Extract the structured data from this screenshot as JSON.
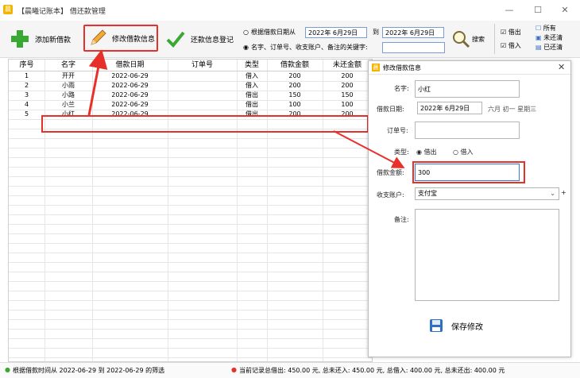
{
  "window": {
    "title": "【晨曦记账本】 借还款管理",
    "icon_glyph": "晨"
  },
  "toolbar": {
    "add_label": "添加新借款",
    "edit_label": "修改借款信息",
    "repay_label": "还款信息登记",
    "radio_date_label": "根据借款日期从",
    "date_from": "2022年 6月29日",
    "to_label": "到",
    "date_to": "2022年 6月29日",
    "radio_keyword_label": "名字、订单号、收支账户、备注的关键字:",
    "keyword_value": "",
    "search_label": "搜索",
    "check_borrow_out": "借出",
    "check_borrow_in": "借入",
    "filter_all": "所有",
    "filter_unpaid": "未还清",
    "filter_paid": "已还清"
  },
  "grid": {
    "columns": [
      "序号",
      "名字",
      "借款日期",
      "订单号",
      "类型",
      "借款金额",
      "未还金额"
    ],
    "rows": [
      [
        "1",
        "开开",
        "2022-06-29",
        "",
        "借入",
        "200",
        "200"
      ],
      [
        "2",
        "小雨",
        "2022-06-29",
        "",
        "借入",
        "200",
        "200"
      ],
      [
        "3",
        "小路",
        "2022-06-29",
        "",
        "借出",
        "150",
        "150"
      ],
      [
        "4",
        "小兰",
        "2022-06-29",
        "",
        "借出",
        "100",
        "100"
      ],
      [
        "5",
        "小红",
        "2022-06-29",
        "",
        "借出",
        "200",
        "200"
      ]
    ]
  },
  "dialog": {
    "title": "修改借款信息",
    "name_label": "名字:",
    "name_value": "小红",
    "date_label": "借款日期:",
    "date_value": "2022年 6月29日",
    "lunar_text": "六月 初一 星期三",
    "order_label": "订单号:",
    "order_value": "",
    "type_label": "类型:",
    "type_out": "借出",
    "type_in": "借入",
    "amount_label": "借款金额:",
    "amount_value": "300",
    "account_label": "收支账户:",
    "account_value": "支付宝",
    "plus": "+",
    "notes_label": "备注:",
    "notes_value": "",
    "save_label": "保存修改"
  },
  "status": {
    "left": "根据借款时间从 2022-06-29 到 2022-06-29 的筛选",
    "right": "当前记录总借出: 450.00 元, 总未还入: 450.00 元, 总借入: 400.00 元, 总未还出: 400.00 元"
  },
  "colors": {
    "accent_red": "#e8302a",
    "header_blue": "#7a9cd3"
  }
}
